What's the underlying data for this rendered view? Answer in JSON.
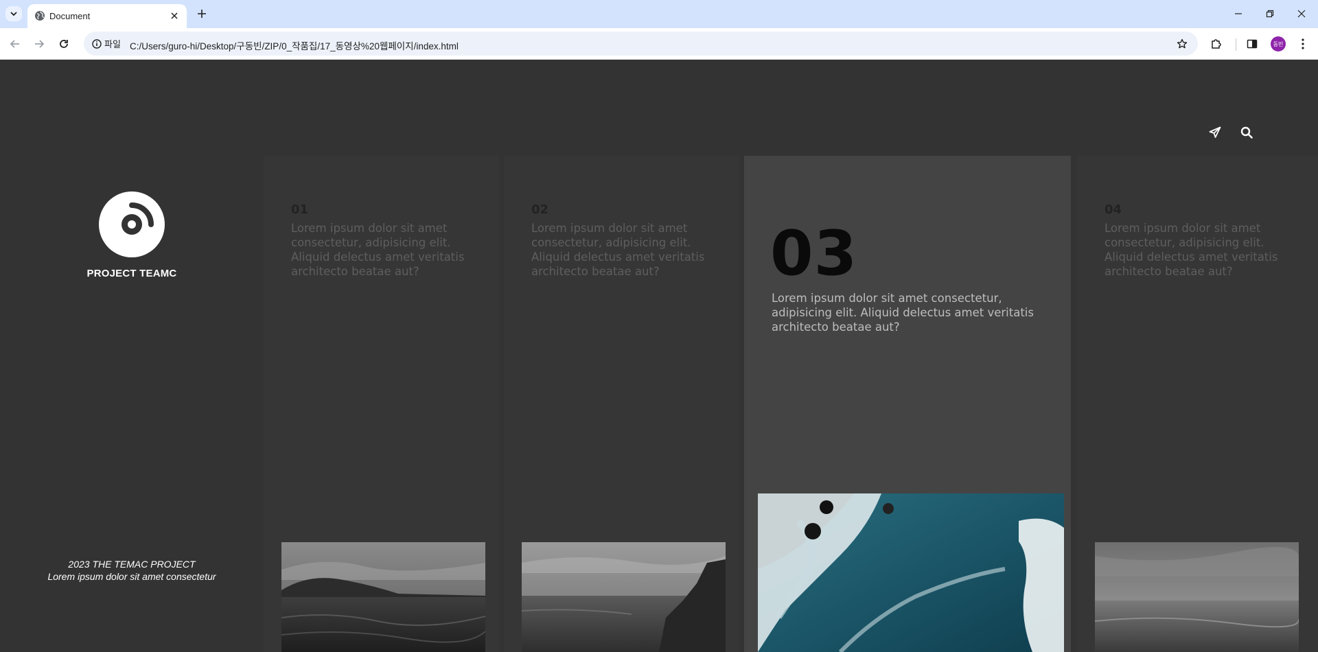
{
  "browser": {
    "tab_title": "Document",
    "site_chip_label": "파일",
    "url": "C:/Users/guro-hi/Desktop/구동빈/ZIP/0_작품집/17_동영상%20웹페이지/index.html",
    "profile_initials": "동빈"
  },
  "brand": {
    "name": "PROJECT TEAMC",
    "logo_icon": "record-disc-icon"
  },
  "header_icons": [
    "paper-plane-icon",
    "search-icon"
  ],
  "footer": {
    "line1": "2023 THE TEMAC PROJECT",
    "line2": "Lorem ipsum dolor sit amet consectetur"
  },
  "panels": [
    {
      "number": "01",
      "text": "Lorem ipsum dolor sit amet consectetur, adipisicing elit. Aliquid delectus amet veritatis architecto beatae aut?",
      "active": false
    },
    {
      "number": "02",
      "text": "Lorem ipsum dolor sit amet consectetur, adipisicing elit. Aliquid delectus amet veritatis architecto beatae aut?",
      "active": false
    },
    {
      "number": "03",
      "text": "Lorem ipsum dolor sit amet consectetur, adipisicing elit. Aliquid delectus amet veritatis architecto beatae aut?",
      "active": true
    },
    {
      "number": "04",
      "text": "Lorem ipsum dolor sit amet consectetur, adipisicing elit. Aliquid delectus amet veritatis architecto beatae aut?",
      "active": false
    }
  ],
  "colors": {
    "page_bg": "#333333",
    "panel_bg": "#363636",
    "active_panel_bg": "#444444"
  }
}
